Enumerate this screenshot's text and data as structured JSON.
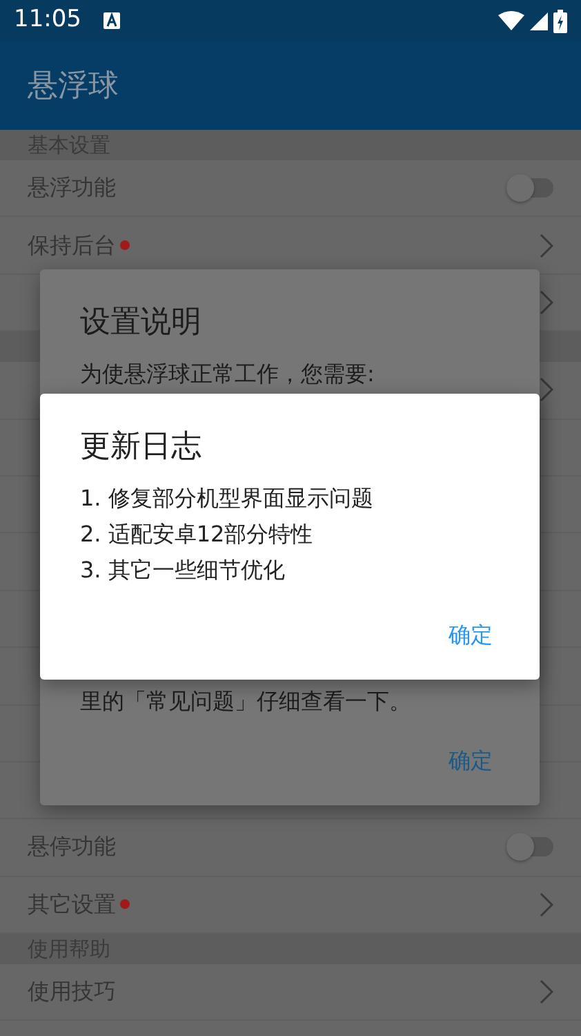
{
  "status_bar": {
    "time": "11:05"
  },
  "app_bar": {
    "title": "悬浮球"
  },
  "settings": [
    {
      "kind": "header",
      "label": "基本设置"
    },
    {
      "kind": "switch",
      "label": "悬浮功能",
      "on": false
    },
    {
      "kind": "link",
      "label": "保持后台",
      "badge": true
    },
    {
      "kind": "link"
    },
    {
      "kind": "header"
    },
    {
      "kind": "link"
    },
    {
      "kind": "value"
    },
    {
      "kind": "value"
    },
    {
      "kind": "value"
    },
    {
      "kind": "value"
    },
    {
      "kind": "value"
    },
    {
      "kind": "value"
    },
    {
      "kind": "value"
    },
    {
      "kind": "switch",
      "label": "悬停功能",
      "on": false
    },
    {
      "kind": "link",
      "label": "其它设置",
      "badge": true
    },
    {
      "kind": "header",
      "label": "使用帮助"
    },
    {
      "kind": "link",
      "label": "使用技巧"
    }
  ],
  "setup_dialog": {
    "title": "设置说明",
    "paragraphs": [
      "为使悬浮球正常工作，您需要:",
      "里的「常见问题」仔细查看一下。"
    ],
    "button": "确定"
  },
  "changelog_dialog": {
    "title": "更新日志",
    "paragraphs": [
      "1. 修复部分机型界面显示问题",
      "2. 适配安卓12部分特性",
      "3. 其它一些细节优化"
    ],
    "button": "确定"
  }
}
